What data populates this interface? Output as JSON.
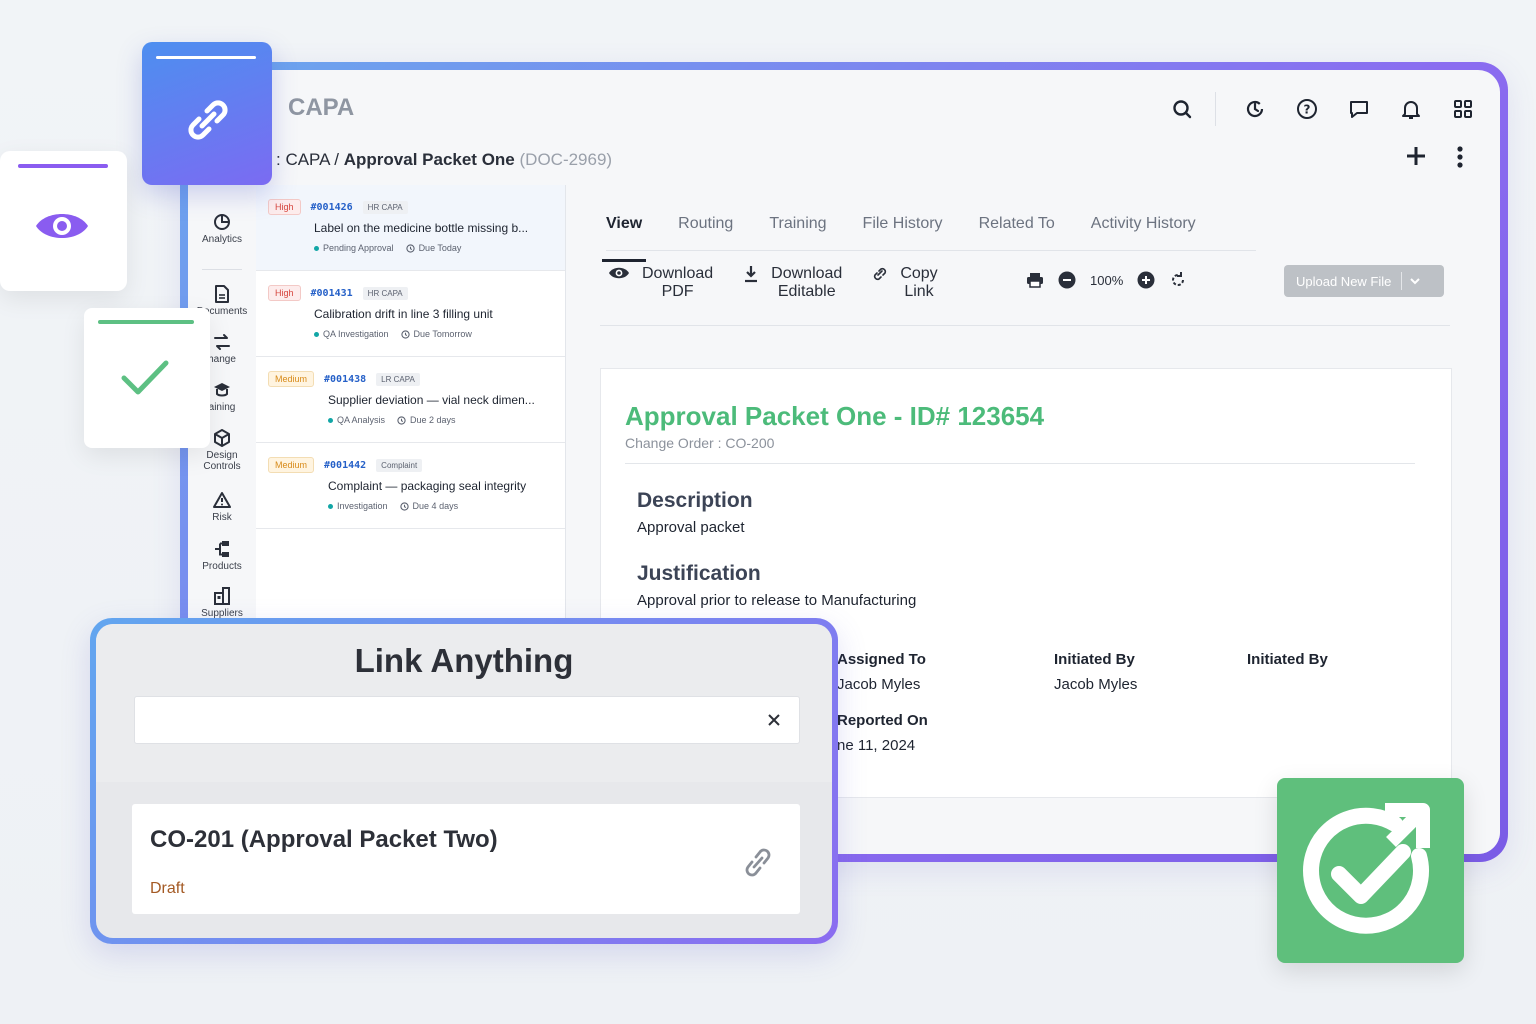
{
  "app": {
    "title": "CAPA"
  },
  "breadcrumb": {
    "prefix": ": CAPA",
    "separator": "/",
    "current": "Approval Packet One",
    "doc_id": "(DOC-2969)"
  },
  "sidebar": {
    "items": [
      {
        "label": "Analytics",
        "icon": "analytics-icon"
      },
      {
        "label": "Documents",
        "icon": "document-icon"
      },
      {
        "label": "hange",
        "icon": "change-icon"
      },
      {
        "label": "aining",
        "icon": "training-icon"
      },
      {
        "label": "Design Controls",
        "icon": "cube-icon"
      },
      {
        "label": "Risk",
        "icon": "warning-icon"
      },
      {
        "label": "Products",
        "icon": "products-icon"
      },
      {
        "label": "Suppliers",
        "icon": "suppliers-icon"
      }
    ]
  },
  "list": {
    "items": [
      {
        "priority": "High",
        "number": "#001426",
        "tag": "HR CAPA",
        "title": "Label on the medicine bottle missing b...",
        "status": "Pending Approval",
        "due": "Due Today"
      },
      {
        "priority": "High",
        "number": "#001431",
        "tag": "HR CAPA",
        "title": "Calibration drift in line 3 filling unit",
        "status": "QA Investigation",
        "due": "Due Tomorrow"
      },
      {
        "priority": "Medium",
        "number": "#001438",
        "tag": "LR CAPA",
        "title": "Supplier deviation — vial neck dimen...",
        "status": "QA Analysis",
        "due": "Due 2 days"
      },
      {
        "priority": "Medium",
        "number": "#001442",
        "tag": "Complaint",
        "title": "Complaint — packaging seal integrity",
        "status": "Investigation",
        "due": "Due 4 days"
      }
    ]
  },
  "tabs": [
    "View",
    "Routing",
    "Training",
    "File History",
    "Related To",
    "Activity History"
  ],
  "toolbar": {
    "download_pdf": [
      "Download",
      "PDF"
    ],
    "download_editable": [
      "Download",
      "Editable"
    ],
    "copy_link": [
      "Copy",
      "Link"
    ],
    "zoom": "100%",
    "upload": "Upload New File"
  },
  "document": {
    "title": "Approval Packet One - ID# 123654",
    "subtitle": "Change Order : CO-200",
    "description_heading": "Description",
    "description": "Approval packet",
    "justification_heading": "Justification",
    "justification": "Approval prior to release to Manufacturing",
    "fields": {
      "assigned_to_label": "Assigned To",
      "assigned_to_value": "Jacob Myles",
      "initiated_by_label": "Initiated By",
      "initiated_by_value": "Jacob Myles",
      "initiated_by2_label": "Initiated By",
      "reported_on_label": "Reported On",
      "reported_on_value": "ne 11, 2024"
    }
  },
  "link_panel": {
    "title": "Link Anything",
    "search_value": "",
    "result_title": "CO-201 (Approval Packet Two)",
    "result_status": "Draft"
  },
  "colors": {
    "accent_green": "#4cbb7a",
    "accent_purple": "#8b6cf0",
    "accent_blue": "#4d8ff0",
    "high": "#d6453d",
    "medium": "#d88b1a"
  }
}
